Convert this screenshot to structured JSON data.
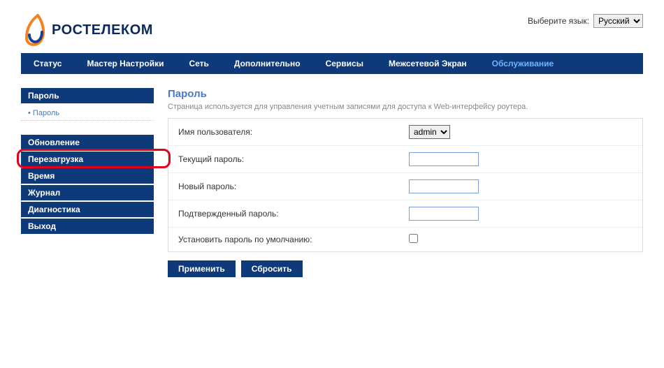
{
  "lang": {
    "label": "Выберите язык:",
    "selected": "Русский",
    "options": [
      "Русский"
    ]
  },
  "logo_text": "РОСТЕЛЕКОМ",
  "nav": [
    {
      "label": "Статус",
      "active": false
    },
    {
      "label": "Мастер Настройки",
      "active": false
    },
    {
      "label": "Сеть",
      "active": false
    },
    {
      "label": "Дополнительно",
      "active": false
    },
    {
      "label": "Сервисы",
      "active": false
    },
    {
      "label": "Межсетевой Экран",
      "active": false
    },
    {
      "label": "Обслуживание",
      "active": true
    }
  ],
  "sidebar": {
    "group_head": "Пароль",
    "group_sub": "Пароль",
    "items": [
      "Обновление",
      "Перезагрузка",
      "Время",
      "Журнал",
      "Диагностика",
      "Выход"
    ],
    "highlighted_index": 1
  },
  "page": {
    "title": "Пароль",
    "description": "Страница используется для управления учетным записями для доступа к Web-интерфейсу роутера."
  },
  "form": {
    "username_label": "Имя пользователя:",
    "username_value": "admin",
    "username_options": [
      "admin"
    ],
    "current_pw_label": "Текущий пароль:",
    "new_pw_label": "Новый пароль:",
    "confirm_pw_label": "Подтвержденный пароль:",
    "default_pw_label": "Установить пароль по умолчанию:",
    "default_pw_checked": false
  },
  "buttons": {
    "apply": "Применить",
    "reset": "Сбросить"
  }
}
